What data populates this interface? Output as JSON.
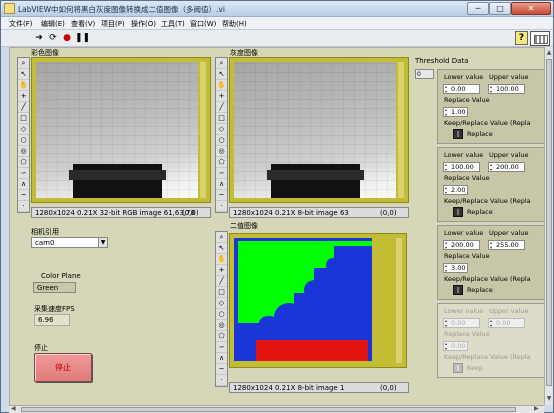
{
  "window": {
    "title": "LabVIEW中如何将黑白灰度图像转换成二值图像（多阈值）.vi",
    "minimize": "─",
    "maximize": "□",
    "close": "✕"
  },
  "menu": [
    "文件(F)",
    "编辑(E)",
    "查看(V)",
    "项目(P)",
    "操作(O)",
    "工具(T)",
    "窗口(W)",
    "帮助(H)"
  ],
  "toolbar": {
    "run_icon": "run-arrow",
    "run_cont_icon": "run-continuously",
    "abort_icon": "abort-stop",
    "pause_icon": "pause",
    "help": "?"
  },
  "color_image": {
    "label": "彩色图像",
    "info": "1280x1024 0.21X 32-bit RGB image 61,63,78",
    "coord": "(0,0)"
  },
  "gray_image": {
    "label": "灰度图像",
    "info": "1280x1024 0.21X 8-bit image 63",
    "coord": "(0,0)"
  },
  "binary_image": {
    "label": "二值图像",
    "info": "1280x1024 0.21X 8-bit image 1",
    "coord": "(0,0)"
  },
  "camera": {
    "label": "相机引用",
    "value": "cam0"
  },
  "color_plane": {
    "label": "Color Plane",
    "value": "Green"
  },
  "fps": {
    "label": "采集速度FPS",
    "value": "6.96"
  },
  "stop": {
    "label": "停止",
    "button": "停止"
  },
  "threshold": {
    "label": "Threshold Data",
    "index": "0",
    "clusters": [
      {
        "lower_label": "Lower value",
        "upper_label": "Upper value",
        "lower": "0.00",
        "upper": "100.00",
        "replace_label": "Replace Value",
        "replace": "1.00",
        "keep_label": "Keep/Replace Value (Repla",
        "switch_label": "Replace",
        "disabled": false
      },
      {
        "lower_label": "Lower value",
        "upper_label": "Upper value",
        "lower": "100.00",
        "upper": "200.00",
        "replace_label": "Replace Value",
        "replace": "2.00",
        "keep_label": "Keep/Replace Value (Repla",
        "switch_label": "Replace",
        "disabled": false
      },
      {
        "lower_label": "Lower value",
        "upper_label": "Upper value",
        "lower": "200.00",
        "upper": "255.00",
        "replace_label": "Replace Value",
        "replace": "3.00",
        "keep_label": "Keep/Replace Value (Repla",
        "switch_label": "Replace",
        "disabled": false
      },
      {
        "lower_label": "Lower value",
        "upper_label": "Upper value",
        "lower": "0.00",
        "upper": "0.00",
        "replace_label": "Replace Value",
        "replace": "0.00",
        "keep_label": "Keep/Replace Value (Repla",
        "switch_label": "Keep",
        "disabled": true
      }
    ]
  },
  "palette_icons": [
    "zoom",
    "pointer",
    "pan",
    "crosshair",
    "line",
    "rectangle",
    "rotated-rectangle",
    "oval",
    "annulus",
    "polygon",
    "freehand",
    "broken-line",
    "freehand-line",
    "point"
  ]
}
